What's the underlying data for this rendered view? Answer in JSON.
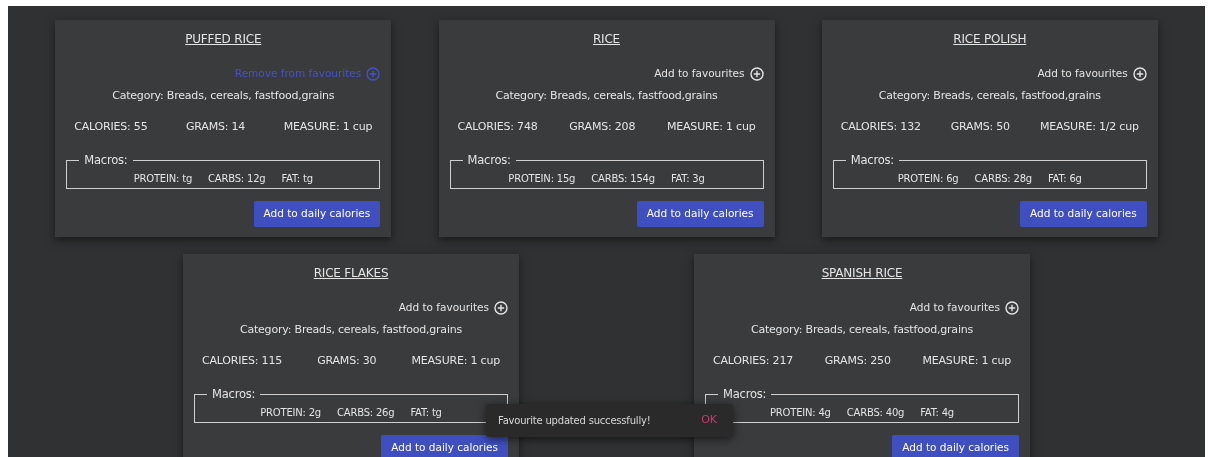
{
  "foods": [
    {
      "name": "PUFFED RICE",
      "favourite": true,
      "favourite_label": "Remove from favourites",
      "category": "Category: Breads, cereals, fastfood,grains",
      "calories": "CALORIES: 55",
      "grams": "GRAMS: 14",
      "measure": "MEASURE: 1 cup",
      "macros_legend": "Macros:",
      "protein": "PROTEIN: tg",
      "carbs": "CARBS: 12g",
      "fat": "FAT: tg",
      "button": "Add to daily calories"
    },
    {
      "name": "RICE",
      "favourite": false,
      "favourite_label": "Add to favourites",
      "category": "Category: Breads, cereals, fastfood,grains",
      "calories": "CALORIES: 748",
      "grams": "GRAMS: 208",
      "measure": "MEASURE: 1 cup",
      "macros_legend": "Macros:",
      "protein": "PROTEIN: 15g",
      "carbs": "CARBS: 154g",
      "fat": "FAT: 3g",
      "button": "Add to daily calories"
    },
    {
      "name": "RICE POLISH",
      "favourite": false,
      "favourite_label": "Add to favourites",
      "category": "Category: Breads, cereals, fastfood,grains",
      "calories": "CALORIES: 132",
      "grams": "GRAMS: 50",
      "measure": "MEASURE: 1/2 cup",
      "macros_legend": "Macros:",
      "protein": "PROTEIN: 6g",
      "carbs": "CARBS: 28g",
      "fat": "FAT: 6g",
      "button": "Add to daily calories"
    },
    {
      "name": "RICE FLAKES",
      "favourite": false,
      "favourite_label": "Add to favourites",
      "category": "Category: Breads, cereals, fastfood,grains",
      "calories": "CALORIES: 115",
      "grams": "GRAMS: 30",
      "measure": "MEASURE: 1 cup",
      "macros_legend": "Macros:",
      "protein": "PROTEIN: 2g",
      "carbs": "CARBS: 26g",
      "fat": "FAT: tg",
      "button": "Add to daily calories"
    },
    {
      "name": "SPANISH RICE",
      "favourite": false,
      "favourite_label": "Add to favourites",
      "category": "Category: Breads, cereals, fastfood,grains",
      "calories": "CALORIES: 217",
      "grams": "GRAMS: 250",
      "measure": "MEASURE: 1 cup",
      "macros_legend": "Macros:",
      "protein": "PROTEIN: 4g",
      "carbs": "CARBS: 40g",
      "fat": "FAT: 4g",
      "button": "Add to daily calories"
    }
  ],
  "snackbar": {
    "message": "Favourite updated successfully!",
    "action": "OK"
  }
}
